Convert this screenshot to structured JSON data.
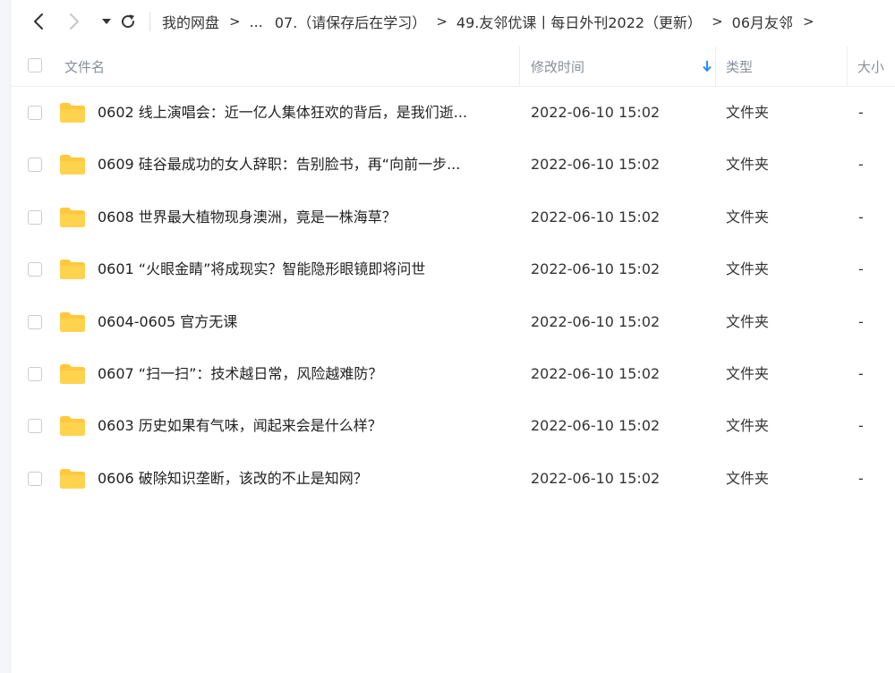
{
  "nav": {
    "breadcrumb": [
      {
        "label": "我的网盘"
      },
      {
        "label": "..."
      },
      {
        "label": "07.（请保存后在学习）"
      },
      {
        "label": "49.友邻优课丨每日外刊2022（更新）"
      },
      {
        "label": "06月友邻"
      }
    ],
    "trailing_arrow": ">"
  },
  "table": {
    "headers": {
      "name": "文件名",
      "modified": "修改时间",
      "type": "类型",
      "size": "大小"
    },
    "sort_column": "modified",
    "sort_direction": "desc",
    "accent_color": "#2a8cf6",
    "folder_color": "#ffc83d",
    "rows": [
      {
        "name": "0602 线上演唱会：近一亿人集体狂欢的背后，是我们逝...",
        "modified": "2022-06-10 15:02",
        "type": "文件夹",
        "size": "-"
      },
      {
        "name": "0609 硅谷最成功的女人辞职：告别脸书，再“向前一步...",
        "modified": "2022-06-10 15:02",
        "type": "文件夹",
        "size": "-"
      },
      {
        "name": "0608 世界最大植物现身澳洲，竟是一株海草？",
        "modified": "2022-06-10 15:02",
        "type": "文件夹",
        "size": "-"
      },
      {
        "name": "0601 “火眼金睛”将成现实？智能隐形眼镜即将问世",
        "modified": "2022-06-10 15:02",
        "type": "文件夹",
        "size": "-"
      },
      {
        "name": "0604-0605 官方无课",
        "modified": "2022-06-10 15:02",
        "type": "文件夹",
        "size": "-"
      },
      {
        "name": "0607 “扫一扫”：技术越日常，风险越难防？",
        "modified": "2022-06-10 15:02",
        "type": "文件夹",
        "size": "-"
      },
      {
        "name": "0603 历史如果有气味，闻起来会是什么样？",
        "modified": "2022-06-10 15:02",
        "type": "文件夹",
        "size": "-"
      },
      {
        "name": "0606 破除知识垄断，该改的不止是知网？",
        "modified": "2022-06-10 15:02",
        "type": "文件夹",
        "size": "-"
      }
    ]
  }
}
